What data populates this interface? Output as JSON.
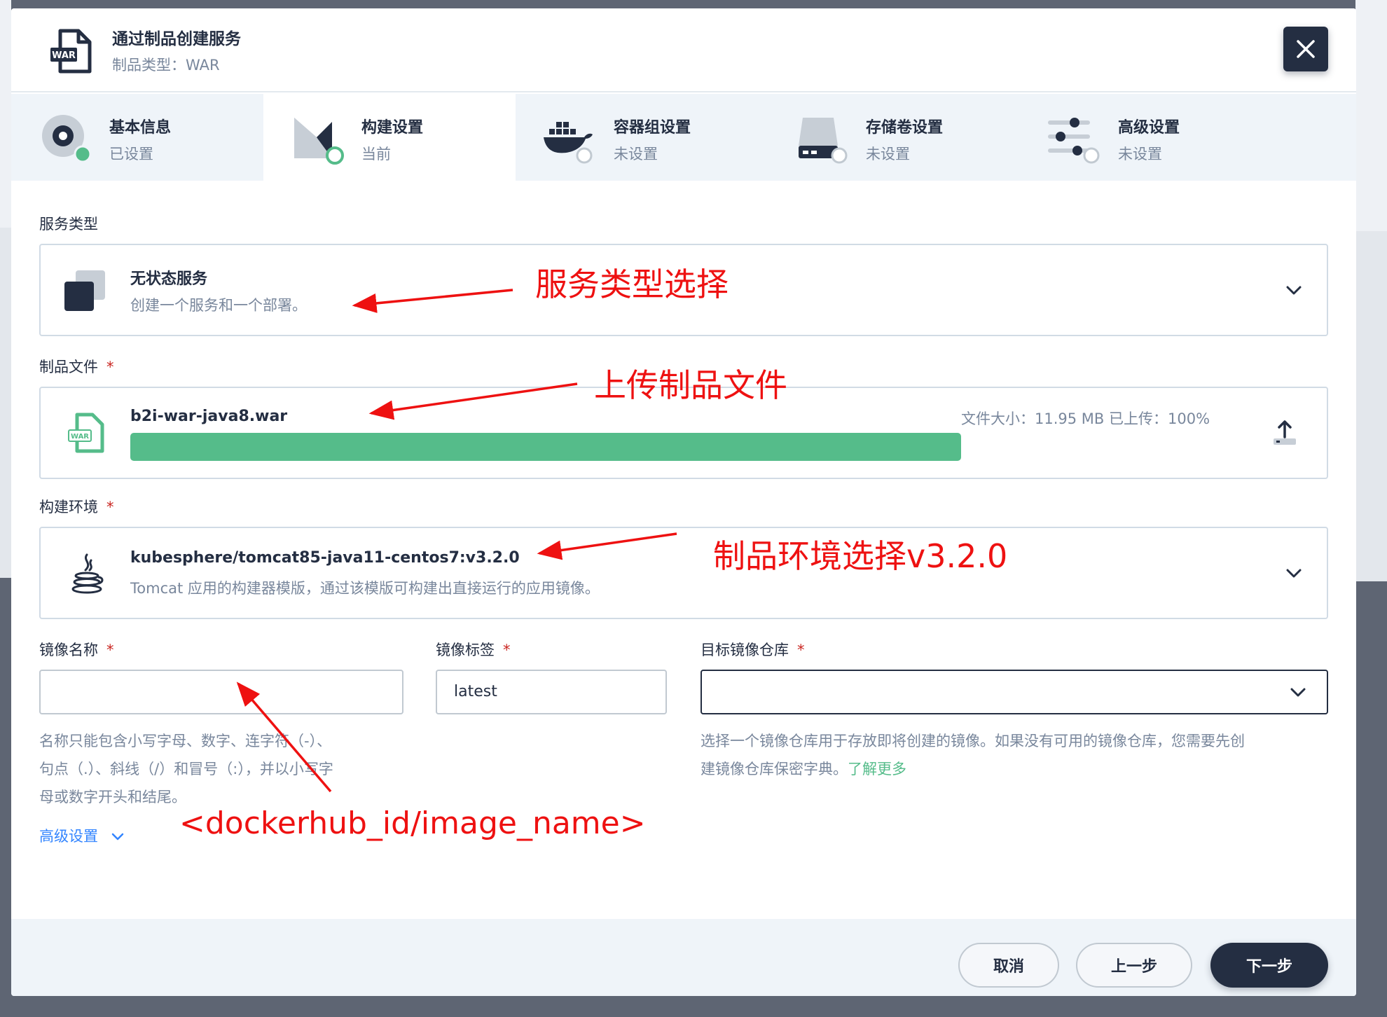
{
  "dialog": {
    "title": "通过制品创建服务",
    "subtitle": "制品类型：WAR",
    "war_badge": "WAR"
  },
  "steps": [
    {
      "title": "基本信息",
      "status": "已设置"
    },
    {
      "title": "构建设置",
      "status": "当前"
    },
    {
      "title": "容器组设置",
      "status": "未设置"
    },
    {
      "title": "存储卷设置",
      "status": "未设置"
    },
    {
      "title": "高级设置",
      "status": "未设置"
    }
  ],
  "service_type": {
    "label": "服务类型",
    "title": "无状态服务",
    "desc": "创建一个服务和一个部署。"
  },
  "artifact": {
    "label": "制品文件",
    "required": "*",
    "file_name": "b2i-war-java8.war",
    "file_badge": "WAR",
    "meta": "文件大小：11.95 MB  已上传：100%",
    "progress": 1.0
  },
  "build_env": {
    "label": "构建环境",
    "required": "*",
    "title": "kubesphere/tomcat85-java11-centos7:v3.2.0",
    "desc": "Tomcat 应用的构建器模版，通过该模版可构建出直接运行的应用镜像。"
  },
  "image_name": {
    "label": "镜像名称",
    "required": "*",
    "value": "",
    "hint_line1": "名称只能包含小写字母、数字、连字符（-）、",
    "hint_line2": "句点（.）、斜线（/）和冒号（:），并以小写字",
    "hint_line3": "母或数字开头和结尾。"
  },
  "image_tag": {
    "label": "镜像标签",
    "required": "*",
    "value": "latest"
  },
  "registry": {
    "label": "目标镜像仓库",
    "required": "*",
    "value": "",
    "hint_line1": "选择一个镜像仓库用于存放即将创建的镜像。如果没有可用的镜像仓库，您需要先创",
    "hint_line2": "建镜像仓库保密字典。",
    "link": "了解更多"
  },
  "advanced_toggle": "高级设置",
  "footer": {
    "cancel": "取消",
    "prev": "上一步",
    "next": "下一步"
  },
  "annotations": {
    "service_type": "服务类型选择",
    "upload": "上传制品文件",
    "env": "制品环境选择v3.2.0",
    "image_name": "<dockerhub_id/image_name>"
  },
  "colors": {
    "primary_dark": "#242e42",
    "success_green": "#55bc8a",
    "annotation_red": "#ee1111",
    "link_blue": "#3385ff"
  }
}
